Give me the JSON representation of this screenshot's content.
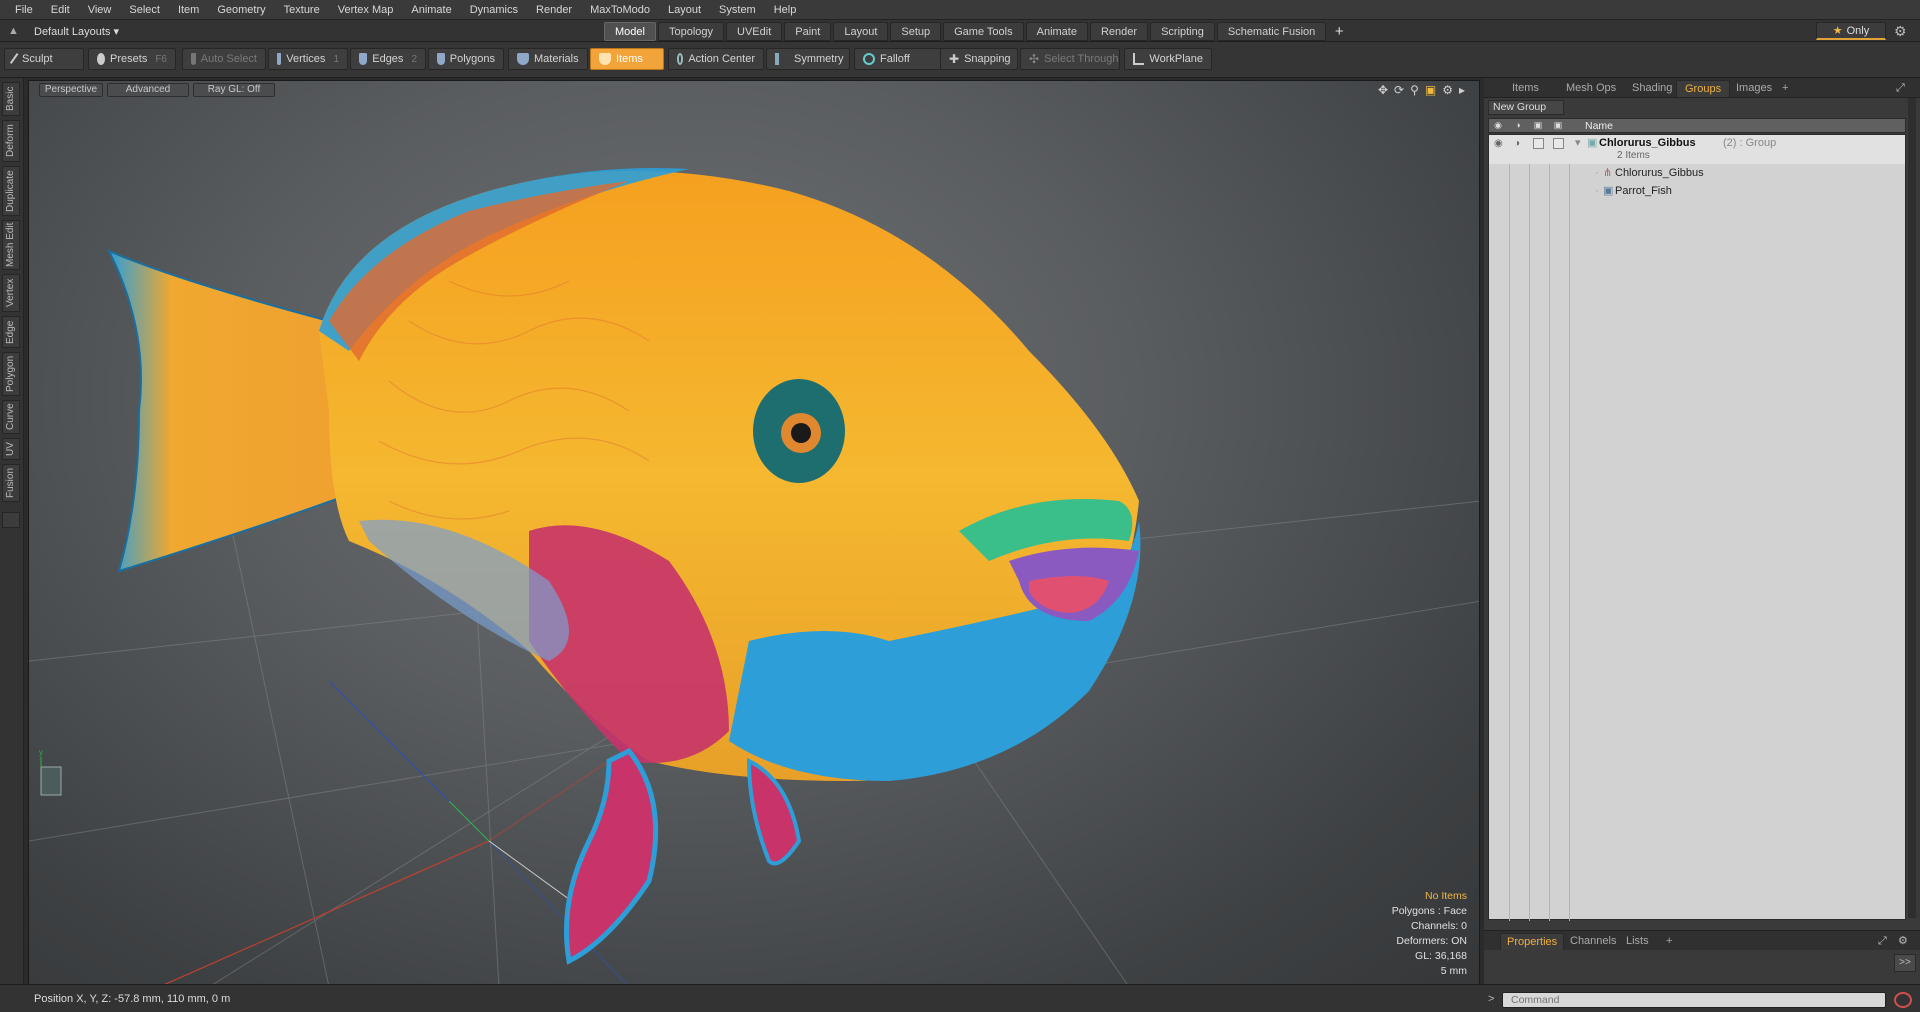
{
  "menu": [
    "File",
    "Edit",
    "View",
    "Select",
    "Item",
    "Geometry",
    "Texture",
    "Vertex Map",
    "Animate",
    "Dynamics",
    "Render",
    "MaxToModo",
    "Layout",
    "System",
    "Help"
  ],
  "layout_selector": "Default Layouts ▾",
  "tabs": [
    "Model",
    "Topology",
    "UVEdit",
    "Paint",
    "Layout",
    "Setup",
    "Game Tools",
    "Animate",
    "Render",
    "Scripting",
    "Schematic Fusion"
  ],
  "active_tab": "Model",
  "tab_add": "+",
  "only_label": "Only",
  "toolbar": {
    "sculpt": "Sculpt",
    "presets": "Presets",
    "presets_key": "F6",
    "auto_select": "Auto Select",
    "vertices": "Vertices",
    "vertices_key": "1",
    "edges": "Edges",
    "edges_key": "2",
    "polygons": "Polygons",
    "materials": "Materials",
    "items": "Items",
    "action_center": "Action Center",
    "symmetry": "Symmetry",
    "falloff": "Falloff",
    "snapping": "Snapping",
    "select_through": "Select Through",
    "workplane": "WorkPlane"
  },
  "left_tabs": [
    "Basic",
    "Deform",
    "Duplicate",
    "Mesh Edit",
    "Vertex",
    "Edge",
    "Polygon",
    "Curve",
    "UV",
    "Fusion"
  ],
  "viewport": {
    "perspective": "Perspective",
    "advanced": "Advanced",
    "raygl": "Ray GL: Off",
    "info": {
      "no_items": "No Items",
      "polygons": "Polygons : Face",
      "channels": "Channels: 0",
      "deformers": "Deformers: ON",
      "gl": "GL: 36,168",
      "scale": "5 mm"
    }
  },
  "right_panel": {
    "tabs": [
      "Items",
      "Mesh Ops",
      "Shading",
      "Groups",
      "Images"
    ],
    "active_tab": "Groups",
    "tab_add": "+",
    "new_group": "New Group",
    "column_name": "Name",
    "rows": {
      "group_name": "Chlorurus_Gibbus",
      "group_meta": "(2) : Group",
      "group_count": "2 Items",
      "child1": "Chlorurus_Gibbus",
      "child2": "Parrot_Fish"
    },
    "bottom_tabs": [
      "Properties",
      "Channels",
      "Lists"
    ],
    "bottom_active": "Properties",
    "bottom_add": "+",
    "expand": ">>"
  },
  "status": {
    "position": "Position X, Y, Z:  -57.8 mm, 110 mm, 0 m",
    "command_placeholder": "Command",
    "command_arrow": ">"
  },
  "colors": {
    "accent": "#f2a33a",
    "fish_yellow": "#f5b830",
    "fish_blue": "#2e9ed8",
    "fish_magenta": "#c8336a",
    "fish_green": "#3bbf8a"
  }
}
